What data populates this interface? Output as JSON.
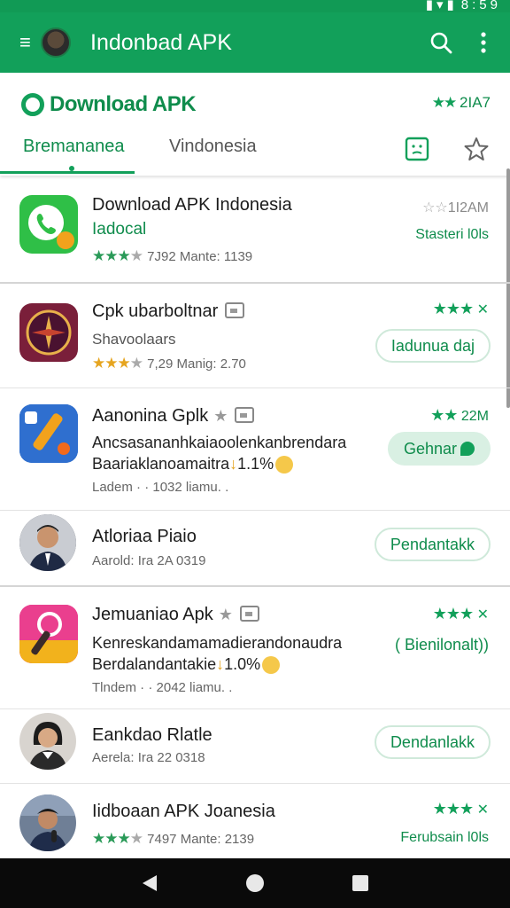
{
  "status_bar": {
    "time": "8:59"
  },
  "app_bar": {
    "title": "Indonbad APK"
  },
  "header": {
    "brand": "Download APK",
    "rating_text": "2IA7",
    "tabs": [
      {
        "label": "Bremananea"
      },
      {
        "label": "Vindonesia"
      }
    ]
  },
  "apps": [
    {
      "name": "Download APK Indonesia",
      "category": "Iadocal",
      "meta": "7J92 Mante: 1139",
      "right_top": "1I2AM",
      "right_bottom": "Stasteri l0ls"
    },
    {
      "name": "Cpk ubarboltnar",
      "category": "Shavoolaars",
      "meta": "7,29 Manig: 2.70",
      "action": "Iadunua daj"
    },
    {
      "name": "Aanonina Gplk",
      "description_line1": "Ancsasananhkaiaoolenkanbrendara",
      "description_line2": "Baariaklanoamaitra",
      "description_suffix": "1.1%",
      "meta": "Ladem · · 1032 liamu. .",
      "right_top": "22M",
      "action": "Gehnar"
    },
    {
      "name": "Atloriaa Piaio",
      "meta": "Aarold: Ira 2A 0319",
      "action": "Pendantakk"
    },
    {
      "name": "Jemuaniao Apk",
      "description_line1": "Kenreskandamamadierandonaudra",
      "description_line2": "Berdalandantakie",
      "description_suffix": "1.0%",
      "meta": "Tlndem · · 2042 liamu. .",
      "action": "( Bienilonalt))"
    },
    {
      "name": "Eankdao Rlatle",
      "meta": "Aerela: Ira 22 0318",
      "action": "Dendanlakk"
    },
    {
      "name": "Iidboaan APK Joanesia",
      "meta": "7497 Mante: 2139",
      "right_bottom": "Ferubsain l0ls"
    }
  ],
  "colors": {
    "primary": "#12a05a",
    "primary_dark": "#0f8c4c",
    "pill_fill": "#d9f0e3"
  },
  "icons": [
    "menu-icon",
    "search-icon",
    "more-vert-icon",
    "face-icon",
    "star-outline-icon",
    "back-icon",
    "home-icon",
    "recents-icon"
  ]
}
